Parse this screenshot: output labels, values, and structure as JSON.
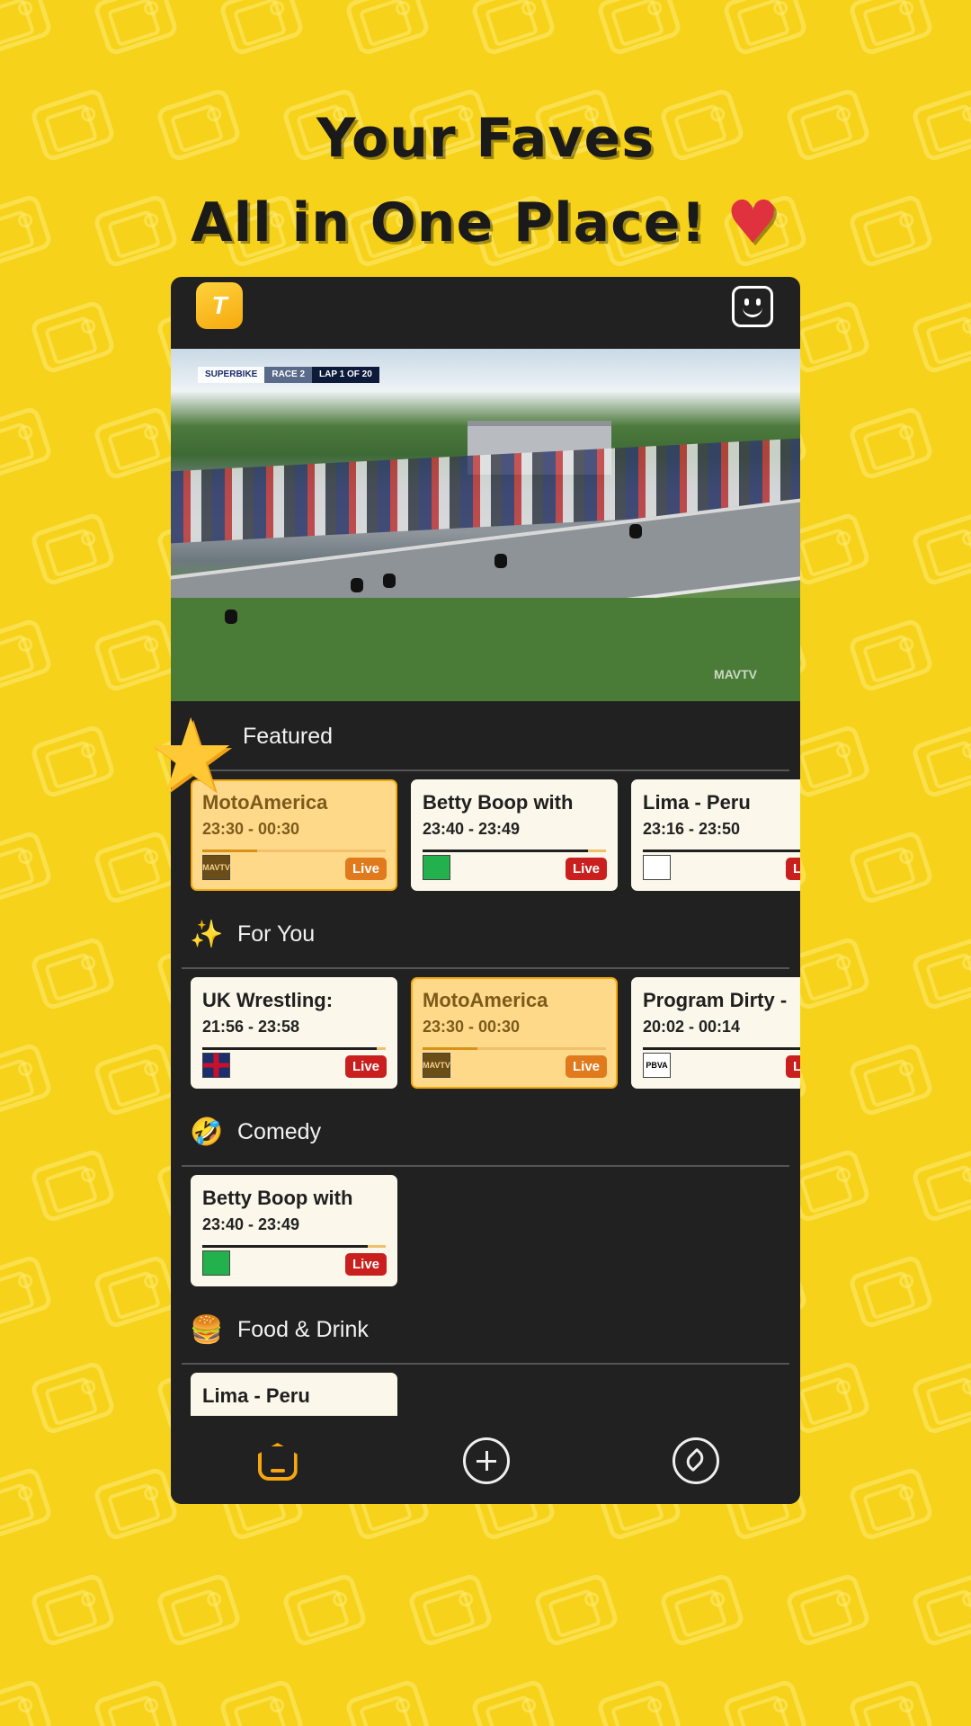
{
  "headline": {
    "line1": "Your Faves",
    "line2": "All in One Place!",
    "heart": "♥"
  },
  "app": {
    "logo_text": "T"
  },
  "video": {
    "overlay": [
      "SUPERBIKE",
      "RACE 2",
      "LAP 1 OF 20"
    ],
    "watermark": "MAVTV"
  },
  "sections": [
    {
      "id": "featured",
      "title": "Featured",
      "icon": "star-icon",
      "cards": [
        {
          "title": "MotoAmerica",
          "time": "23:30 - 00:30",
          "live": "Live",
          "active": true,
          "progress": 0.3,
          "logo": "MAVTV"
        },
        {
          "title": "Betty Boop with",
          "time": "23:40 - 23:49",
          "live": "Live",
          "active": false,
          "progress": 0.9,
          "logo": ""
        },
        {
          "title": "Lima - Peru",
          "time": "23:16 - 23:50",
          "live": "Live",
          "active": false,
          "progress": 0.9,
          "logo": ""
        }
      ]
    },
    {
      "id": "for-you",
      "title": "For You",
      "icon": "magic-wand-icon",
      "cards": [
        {
          "title": "UK Wrestling:",
          "time": "21:56 - 23:58",
          "live": "Live",
          "active": false,
          "progress": 0.95,
          "logo": ""
        },
        {
          "title": "MotoAmerica",
          "time": "23:30 - 00:30",
          "live": "Live",
          "active": true,
          "progress": 0.3,
          "logo": "MAVTV"
        },
        {
          "title": "Program Dirty -",
          "time": "20:02 - 00:14",
          "live": "Live",
          "active": false,
          "progress": 0.9,
          "logo": "PBVA"
        }
      ]
    },
    {
      "id": "comedy",
      "title": "Comedy",
      "icon": "laughing-face-icon",
      "cards": [
        {
          "title": "Betty Boop with",
          "time": "23:40 - 23:49",
          "live": "Live",
          "active": false,
          "progress": 0.9,
          "logo": ""
        }
      ]
    },
    {
      "id": "food-drink",
      "title": "Food & Drink",
      "icon": "burger-icon",
      "cards": [
        {
          "title": "Lima - Peru",
          "time": "",
          "live": "",
          "active": false,
          "progress": 0,
          "logo": ""
        }
      ]
    }
  ],
  "nav": {
    "items": [
      "home-icon",
      "add-icon",
      "compass-icon"
    ],
    "active": "home-icon"
  },
  "colors": {
    "background": "#f7d21a",
    "panel": "#212121",
    "accent": "#f5a70f",
    "live": "#c9201f",
    "heart": "#e0313e"
  }
}
